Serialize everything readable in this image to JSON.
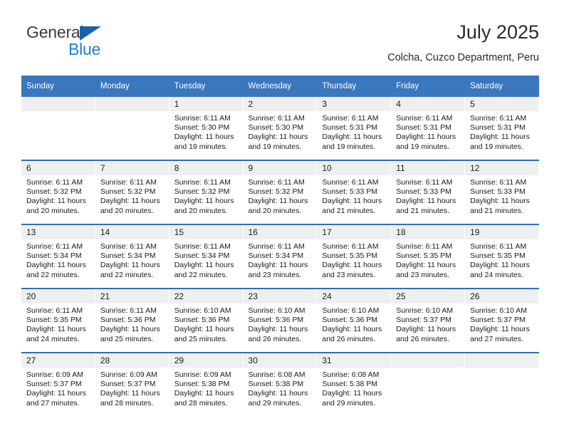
{
  "brand": {
    "name_part1": "General",
    "name_part2": "Blue",
    "triangle_color": "#1464ac",
    "blue_color": "#1f7fd4"
  },
  "header": {
    "title": "July 2025",
    "subtitle": "Colcha, Cuzco Department, Peru"
  },
  "theme": {
    "header_bar_color": "#3a77bd",
    "row_rule_color": "#2f6fb5",
    "daynum_band_color": "#efefef"
  },
  "calendar": {
    "weekday_headers": [
      "Sunday",
      "Monday",
      "Tuesday",
      "Wednesday",
      "Thursday",
      "Friday",
      "Saturday"
    ],
    "weeks": [
      [
        {
          "day": "",
          "sunrise": "",
          "sunset": "",
          "daylight": ""
        },
        {
          "day": "",
          "sunrise": "",
          "sunset": "",
          "daylight": ""
        },
        {
          "day": "1",
          "sunrise": "Sunrise: 6:11 AM",
          "sunset": "Sunset: 5:30 PM",
          "daylight": "Daylight: 11 hours and 19 minutes."
        },
        {
          "day": "2",
          "sunrise": "Sunrise: 6:11 AM",
          "sunset": "Sunset: 5:30 PM",
          "daylight": "Daylight: 11 hours and 19 minutes."
        },
        {
          "day": "3",
          "sunrise": "Sunrise: 6:11 AM",
          "sunset": "Sunset: 5:31 PM",
          "daylight": "Daylight: 11 hours and 19 minutes."
        },
        {
          "day": "4",
          "sunrise": "Sunrise: 6:11 AM",
          "sunset": "Sunset: 5:31 PM",
          "daylight": "Daylight: 11 hours and 19 minutes."
        },
        {
          "day": "5",
          "sunrise": "Sunrise: 6:11 AM",
          "sunset": "Sunset: 5:31 PM",
          "daylight": "Daylight: 11 hours and 19 minutes."
        }
      ],
      [
        {
          "day": "6",
          "sunrise": "Sunrise: 6:11 AM",
          "sunset": "Sunset: 5:32 PM",
          "daylight": "Daylight: 11 hours and 20 minutes."
        },
        {
          "day": "7",
          "sunrise": "Sunrise: 6:11 AM",
          "sunset": "Sunset: 5:32 PM",
          "daylight": "Daylight: 11 hours and 20 minutes."
        },
        {
          "day": "8",
          "sunrise": "Sunrise: 6:11 AM",
          "sunset": "Sunset: 5:32 PM",
          "daylight": "Daylight: 11 hours and 20 minutes."
        },
        {
          "day": "9",
          "sunrise": "Sunrise: 6:11 AM",
          "sunset": "Sunset: 5:32 PM",
          "daylight": "Daylight: 11 hours and 20 minutes."
        },
        {
          "day": "10",
          "sunrise": "Sunrise: 6:11 AM",
          "sunset": "Sunset: 5:33 PM",
          "daylight": "Daylight: 11 hours and 21 minutes."
        },
        {
          "day": "11",
          "sunrise": "Sunrise: 6:11 AM",
          "sunset": "Sunset: 5:33 PM",
          "daylight": "Daylight: 11 hours and 21 minutes."
        },
        {
          "day": "12",
          "sunrise": "Sunrise: 6:11 AM",
          "sunset": "Sunset: 5:33 PM",
          "daylight": "Daylight: 11 hours and 21 minutes."
        }
      ],
      [
        {
          "day": "13",
          "sunrise": "Sunrise: 6:11 AM",
          "sunset": "Sunset: 5:34 PM",
          "daylight": "Daylight: 11 hours and 22 minutes."
        },
        {
          "day": "14",
          "sunrise": "Sunrise: 6:11 AM",
          "sunset": "Sunset: 5:34 PM",
          "daylight": "Daylight: 11 hours and 22 minutes."
        },
        {
          "day": "15",
          "sunrise": "Sunrise: 6:11 AM",
          "sunset": "Sunset: 5:34 PM",
          "daylight": "Daylight: 11 hours and 22 minutes."
        },
        {
          "day": "16",
          "sunrise": "Sunrise: 6:11 AM",
          "sunset": "Sunset: 5:34 PM",
          "daylight": "Daylight: 11 hours and 23 minutes."
        },
        {
          "day": "17",
          "sunrise": "Sunrise: 6:11 AM",
          "sunset": "Sunset: 5:35 PM",
          "daylight": "Daylight: 11 hours and 23 minutes."
        },
        {
          "day": "18",
          "sunrise": "Sunrise: 6:11 AM",
          "sunset": "Sunset: 5:35 PM",
          "daylight": "Daylight: 11 hours and 23 minutes."
        },
        {
          "day": "19",
          "sunrise": "Sunrise: 6:11 AM",
          "sunset": "Sunset: 5:35 PM",
          "daylight": "Daylight: 11 hours and 24 minutes."
        }
      ],
      [
        {
          "day": "20",
          "sunrise": "Sunrise: 6:11 AM",
          "sunset": "Sunset: 5:35 PM",
          "daylight": "Daylight: 11 hours and 24 minutes."
        },
        {
          "day": "21",
          "sunrise": "Sunrise: 6:11 AM",
          "sunset": "Sunset: 5:36 PM",
          "daylight": "Daylight: 11 hours and 25 minutes."
        },
        {
          "day": "22",
          "sunrise": "Sunrise: 6:10 AM",
          "sunset": "Sunset: 5:36 PM",
          "daylight": "Daylight: 11 hours and 25 minutes."
        },
        {
          "day": "23",
          "sunrise": "Sunrise: 6:10 AM",
          "sunset": "Sunset: 5:36 PM",
          "daylight": "Daylight: 11 hours and 26 minutes."
        },
        {
          "day": "24",
          "sunrise": "Sunrise: 6:10 AM",
          "sunset": "Sunset: 5:36 PM",
          "daylight": "Daylight: 11 hours and 26 minutes."
        },
        {
          "day": "25",
          "sunrise": "Sunrise: 6:10 AM",
          "sunset": "Sunset: 5:37 PM",
          "daylight": "Daylight: 11 hours and 26 minutes."
        },
        {
          "day": "26",
          "sunrise": "Sunrise: 6:10 AM",
          "sunset": "Sunset: 5:37 PM",
          "daylight": "Daylight: 11 hours and 27 minutes."
        }
      ],
      [
        {
          "day": "27",
          "sunrise": "Sunrise: 6:09 AM",
          "sunset": "Sunset: 5:37 PM",
          "daylight": "Daylight: 11 hours and 27 minutes."
        },
        {
          "day": "28",
          "sunrise": "Sunrise: 6:09 AM",
          "sunset": "Sunset: 5:37 PM",
          "daylight": "Daylight: 11 hours and 28 minutes."
        },
        {
          "day": "29",
          "sunrise": "Sunrise: 6:09 AM",
          "sunset": "Sunset: 5:38 PM",
          "daylight": "Daylight: 11 hours and 28 minutes."
        },
        {
          "day": "30",
          "sunrise": "Sunrise: 6:08 AM",
          "sunset": "Sunset: 5:38 PM",
          "daylight": "Daylight: 11 hours and 29 minutes."
        },
        {
          "day": "31",
          "sunrise": "Sunrise: 6:08 AM",
          "sunset": "Sunset: 5:38 PM",
          "daylight": "Daylight: 11 hours and 29 minutes."
        },
        {
          "day": "",
          "sunrise": "",
          "sunset": "",
          "daylight": ""
        },
        {
          "day": "",
          "sunrise": "",
          "sunset": "",
          "daylight": ""
        }
      ]
    ]
  }
}
